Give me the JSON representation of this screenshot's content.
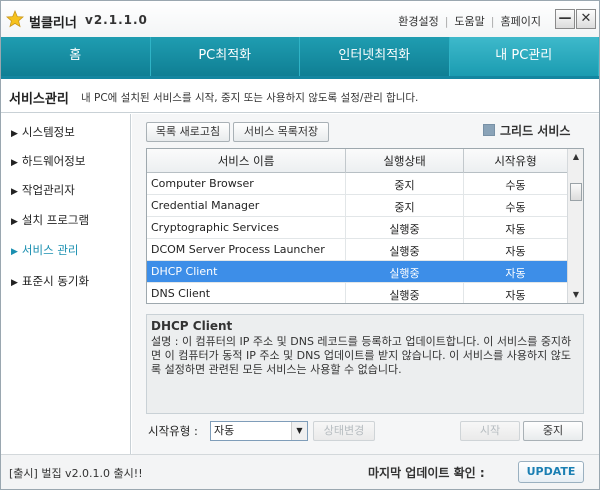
{
  "app": {
    "name": "벌클리너",
    "version": "v2.1.1.0"
  },
  "toplinks": [
    "환경설정",
    "도움말",
    "홈페이지"
  ],
  "window_buttons": {
    "minimize": "—",
    "close": "✕"
  },
  "tabs": [
    {
      "label": "홈",
      "active": false
    },
    {
      "label": "PC최적화",
      "active": false
    },
    {
      "label": "인터넷최적화",
      "active": false
    },
    {
      "label": "내 PC관리",
      "active": true
    }
  ],
  "section": {
    "title": "서비스관리",
    "description": "내 PC에 설치된 서비스를 시작, 중지 또는 사용하지 않도록 설정/관리 합니다."
  },
  "nav": {
    "items": [
      {
        "label": "시스템정보",
        "active": false
      },
      {
        "label": "하드웨어정보",
        "active": false
      },
      {
        "label": "작업관리자",
        "active": false
      },
      {
        "label": "설치 프로그램",
        "active": false
      },
      {
        "label": "서비스 관리",
        "active": true
      },
      {
        "label": "표준시 동기화",
        "active": false
      }
    ]
  },
  "toolbar": {
    "refresh_label": "목록 새로고침",
    "save_label": "서비스 목록저장",
    "grid_label": "그리드 서비스"
  },
  "table": {
    "headers": [
      "서비스 이름",
      "실행상태",
      "시작유형"
    ],
    "rows": [
      {
        "name": "Computer Browser",
        "status": "중지",
        "type": "수동",
        "selected": false
      },
      {
        "name": "Credential Manager",
        "status": "중지",
        "type": "수동",
        "selected": false
      },
      {
        "name": "Cryptographic Services",
        "status": "실행중",
        "type": "자동",
        "selected": false
      },
      {
        "name": "DCOM Server Process Launcher",
        "status": "실행중",
        "type": "자동",
        "selected": false
      },
      {
        "name": "DHCP Client",
        "status": "실행중",
        "type": "자동",
        "selected": true
      },
      {
        "name": "DNS Client",
        "status": "실행중",
        "type": "자동",
        "selected": false
      }
    ]
  },
  "detail": {
    "name": "DHCP Client",
    "text": "설명 : 이 컴퓨터의 IP 주소 및 DNS 레코드를 등록하고 업데이트합니다. 이 서비스를 중지하면 이 컴퓨터가 동적 IP 주소 및 DNS 업데이트를 받지 않습니다. 이 서비스를 사용하지 않도록 설정하면 관련된 모든 서비스는 사용할 수 없습니다."
  },
  "controls": {
    "start_type_label": "시작유형 :",
    "start_type_value": "자동",
    "change_state_label": "상태변경",
    "start_label": "시작",
    "stop_label": "중지"
  },
  "footer": {
    "left": "[출시] 벌집 v2.0.1.0 출시!!",
    "right": "마지막 업데이트 확인 :",
    "update_label": "UPDATE"
  },
  "colors": {
    "tab_bg": "#1486a0",
    "accent": "#1a8fb0",
    "selection": "#3d8ee8"
  }
}
